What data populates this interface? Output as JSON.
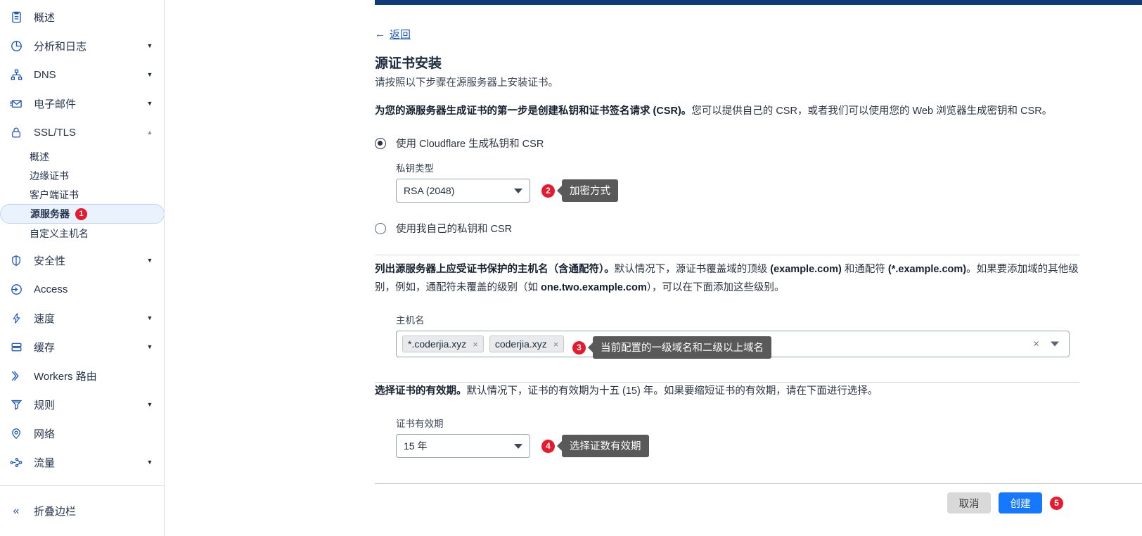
{
  "sidebar": {
    "items": [
      {
        "label": "概述",
        "icon": "clipboard-icon",
        "expandable": false,
        "key": "overview"
      },
      {
        "label": "分析和日志",
        "icon": "pie-chart-icon",
        "expandable": true,
        "key": "analytics"
      },
      {
        "label": "DNS",
        "icon": "sitemap-icon",
        "expandable": true,
        "key": "dns"
      },
      {
        "label": "电子邮件",
        "icon": "envelope-icon",
        "expandable": true,
        "key": "email"
      },
      {
        "label": "SSL/TLS",
        "icon": "lock-icon",
        "expandable": true,
        "key": "ssltls",
        "expanded": true
      },
      {
        "label": "安全性",
        "icon": "shield-icon",
        "expandable": true,
        "key": "security"
      },
      {
        "label": "Access",
        "icon": "access-icon",
        "expandable": false,
        "key": "access"
      },
      {
        "label": "速度",
        "icon": "bolt-icon",
        "expandable": true,
        "key": "speed"
      },
      {
        "label": "缓存",
        "icon": "database-icon",
        "expandable": true,
        "key": "cache"
      },
      {
        "label": "Workers 路由",
        "icon": "workers-icon",
        "expandable": false,
        "key": "workers"
      },
      {
        "label": "规则",
        "icon": "rules-icon",
        "expandable": true,
        "key": "rules"
      },
      {
        "label": "网络",
        "icon": "pin-icon",
        "expandable": false,
        "key": "network"
      },
      {
        "label": "流量",
        "icon": "traffic-icon",
        "expandable": true,
        "key": "traffic"
      }
    ],
    "ssl_children": [
      {
        "label": "概述",
        "active": false,
        "badge": ""
      },
      {
        "label": "边缘证书",
        "active": false,
        "badge": ""
      },
      {
        "label": "客户端证书",
        "active": false,
        "badge": ""
      },
      {
        "label": "源服务器",
        "active": true,
        "badge": "1"
      },
      {
        "label": "自定义主机名",
        "active": false,
        "badge": ""
      }
    ],
    "footer": {
      "label": "折叠边栏",
      "icon": "chevron-double-left-icon"
    }
  },
  "main": {
    "back_label": "返回",
    "title": "源证书安装",
    "subtitle": "请按照以下步骤在源服务器上安装证书。",
    "csr_section": {
      "paragraph_bold": "为您的源服务器生成证书的第一步是创建私钥和证书签名请求 (CSR)。",
      "paragraph_rest": "您可以提供自己的 CSR，或者我们可以使用您的 Web 浏览器生成密钥和 CSR。",
      "option_generate": "使用 Cloudflare 生成私钥和 CSR",
      "option_own": "使用我自己的私钥和 CSR",
      "key_type_label": "私钥类型",
      "key_type_value": "RSA (2048)",
      "annotation_num": "2",
      "annotation_text": "加密方式"
    },
    "hosts_section": {
      "paragraph_bold": "列出源服务器上应受证书保护的主机名（含通配符）。",
      "paragraph_rest_1": "默认情况下，源证书覆盖域的顶级 ",
      "paragraph_b1": "(example.com)",
      "paragraph_rest_2": " 和通配符 ",
      "paragraph_b2": "(*.example.com)",
      "paragraph_rest_3": "。如果要添加域的其他级别，例如，通配符未覆盖的级别（如 ",
      "paragraph_b3": "one.two.example.com",
      "paragraph_rest_4": "），可以在下面添加这些级别。",
      "field_label": "主机名",
      "tokens": [
        "*.coderjia.xyz",
        "coderjia.xyz"
      ],
      "clear_icon": "close-icon",
      "dropdown_icon": "chevron-down-icon",
      "annotation_num": "3",
      "annotation_text": "当前配置的一级域名和二级以上域名"
    },
    "validity_section": {
      "paragraph_bold": "选择证书的有效期。",
      "paragraph_rest": "默认情况下，证书的有效期为十五 (15) 年。如果要缩短证书的有效期，请在下面进行选择。",
      "field_label": "证书有效期",
      "value": "15 年",
      "annotation_num": "4",
      "annotation_text": "选择证数有效期"
    },
    "footer": {
      "cancel_label": "取消",
      "create_label": "创建",
      "annotation_num": "5"
    }
  },
  "colors": {
    "accent_blue": "#1f57c3",
    "primary_button": "#1677ff",
    "badge_red": "#e8192c",
    "tooltip_gray": "#595959",
    "topbar_navy": "#123a77",
    "active_nav_bg": "#eaf2fd"
  }
}
